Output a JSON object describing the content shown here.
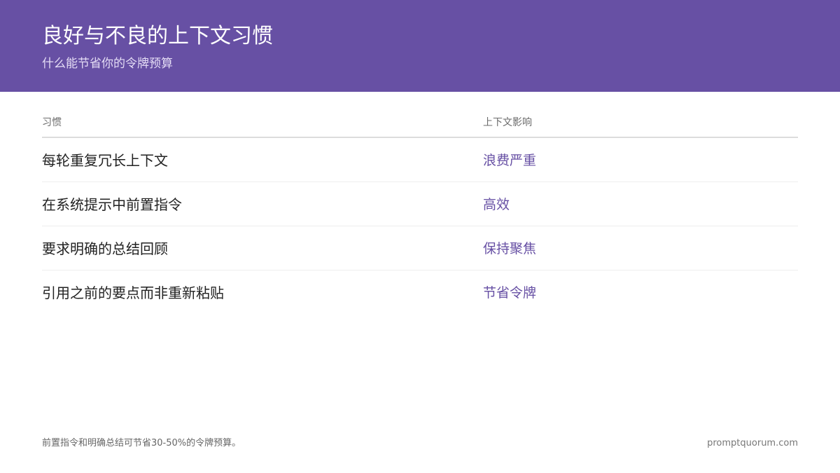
{
  "header": {
    "title": "良好与不良的上下文习惯",
    "subtitle": "什么能节省你的令牌预算"
  },
  "table": {
    "columns": [
      "习惯",
      "上下文影响"
    ],
    "rows": [
      {
        "habit": "每轮重复冗长上下文",
        "impact": "浪费严重"
      },
      {
        "habit": "在系统提示中前置指令",
        "impact": "高效"
      },
      {
        "habit": "要求明确的总结回顾",
        "impact": "保持聚焦"
      },
      {
        "habit": "引用之前的要点而非重新粘贴",
        "impact": "节省令牌"
      }
    ]
  },
  "footer": {
    "note": "前置指令和明确总结可节省30-50%的令牌预算。",
    "brand": "promptquorum.com"
  },
  "colors": {
    "accent": "#6750a4",
    "header_bg": "#6750a4"
  }
}
